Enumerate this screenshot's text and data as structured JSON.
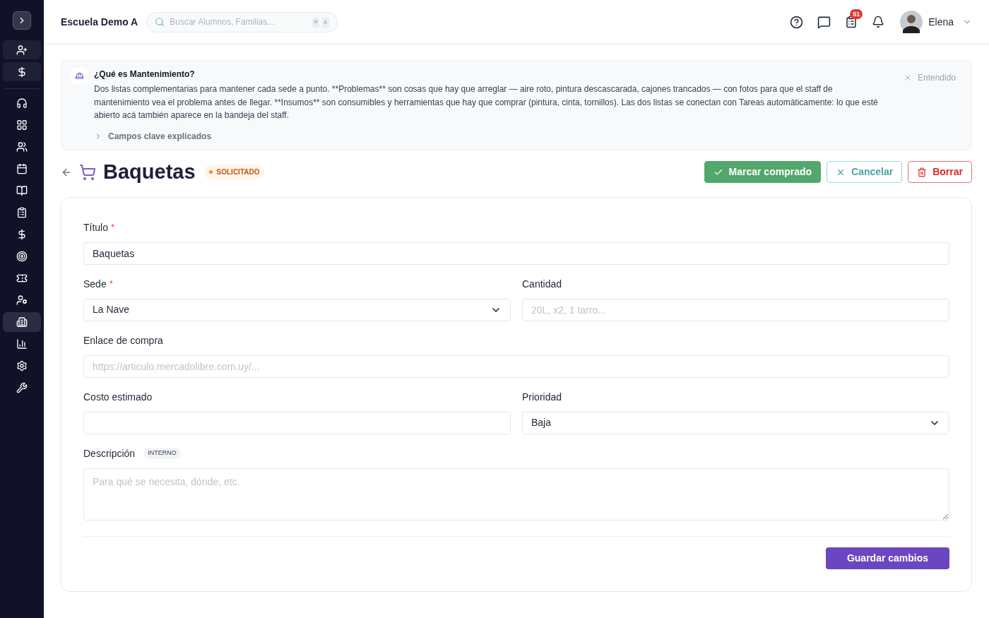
{
  "sidebar": {
    "quick_actions": [
      {
        "kind": "add-user"
      },
      {
        "kind": "money"
      }
    ],
    "items": [
      {
        "selected": false
      },
      {
        "selected": false
      },
      {
        "selected": false
      },
      {
        "selected": false
      },
      {
        "selected": false
      },
      {
        "selected": false
      },
      {
        "selected": false
      },
      {
        "selected": false
      },
      {
        "selected": false
      },
      {
        "selected": false
      },
      {
        "selected": true
      },
      {
        "selected": false
      },
      {
        "selected": false
      },
      {
        "selected": false
      }
    ]
  },
  "header": {
    "school": "Escuela Demo A",
    "search": {
      "placeholder": "Buscar Alumnos, Familias...",
      "keys": [
        "⌘",
        "K"
      ]
    },
    "tasks_badge": "51",
    "user": "Elena"
  },
  "info": {
    "title": "¿Qué es Mantenimiento?",
    "body": "Dos listas complementarias para mantener cada sede a punto. **Problemas** son cosas que hay que arreglar — aire roto, pintura descascarada, cajones trancados — con fotos para que el staff de mantenimiento vea el problema antes de llegar. **Insumos** son consumibles y herramientas que hay que comprar (pintura, cinta, tornillos). Las dos listas se conectan con Tareas automáticamente: lo que esté abierto acá también aparece en la bandeja del staff.",
    "details": "Campos clave explicados",
    "dismiss": "Entendido"
  },
  "page": {
    "title": "Baquetas",
    "status": "SOLICITADO",
    "actions": [
      {
        "kind": "success",
        "label": "Marcar comprado"
      },
      {
        "kind": "neutral",
        "label": "Cancelar"
      },
      {
        "kind": "danger",
        "label": "Borrar"
      }
    ]
  },
  "form": {
    "rows": [
      [
        {
          "kind": "text",
          "label": "Título",
          "required_mark": "*",
          "value": "Baquetas"
        }
      ],
      [
        {
          "kind": "select",
          "label": "Sede",
          "required_mark": "*",
          "value": "La Nave"
        },
        {
          "kind": "text",
          "label": "Cantidad",
          "placeholder": "20L, x2, 1 tarro..."
        }
      ],
      [
        {
          "kind": "text",
          "label": "Enlace de compra",
          "placeholder": "https://articulo.mercadolibre.com.uy/..."
        }
      ],
      [
        {
          "kind": "text",
          "label": "Costo estimado"
        },
        {
          "kind": "select",
          "label": "Prioridad",
          "value": "Baja"
        }
      ],
      [
        {
          "kind": "textarea",
          "label": "Descripción",
          "tag": "INTERNO",
          "placeholder": "Para qué se necesita, dónde, etc."
        }
      ]
    ],
    "save": "Guardar cambios"
  }
}
